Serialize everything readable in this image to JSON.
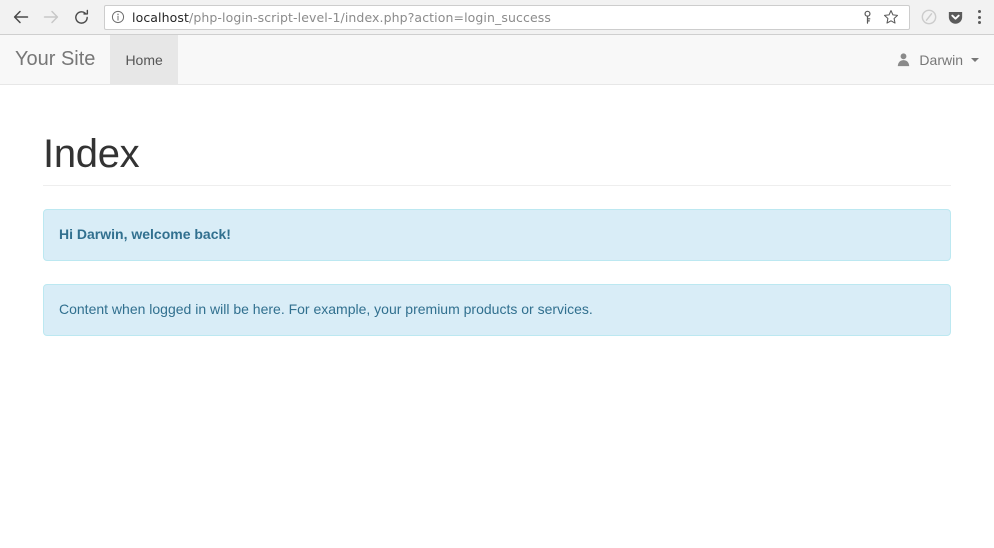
{
  "browser": {
    "back_icon": "back-arrow-icon",
    "forward_icon": "forward-arrow-icon",
    "reload_icon": "reload-icon",
    "info_icon": "page-info-icon",
    "url_host": "localhost",
    "url_path": "/php-login-script-level-1/index.php?action=login_success",
    "url_full": "localhost/php-login-script-level-1/index.php?action=login_success",
    "save_password_icon": "key-icon",
    "bookmark_icon": "star-icon",
    "extension_icon": "extension-circle-icon",
    "pocket_icon": "pocket-shield-icon",
    "menu_icon": "three-dot-menu-icon"
  },
  "navbar": {
    "brand": "Your Site",
    "links": [
      {
        "label": "Home",
        "active": true
      }
    ],
    "user": {
      "avatar_icon": "user-person-icon",
      "name": "Darwin",
      "caret_icon": "caret-down-icon"
    }
  },
  "main": {
    "title": "Index",
    "alerts": [
      {
        "text": "Hi Darwin, welcome back!",
        "style": "strong"
      },
      {
        "text": "Content when logged in will be here. For example, your premium products or services.",
        "style": "normal"
      }
    ]
  },
  "colors": {
    "alert_bg": "#d9edf7",
    "alert_border": "#bce8f1",
    "alert_text": "#31708f",
    "navbar_bg": "#f8f8f8",
    "navbar_active_bg": "#e7e7e7",
    "muted_text": "#777777",
    "heading_text": "#333333"
  }
}
